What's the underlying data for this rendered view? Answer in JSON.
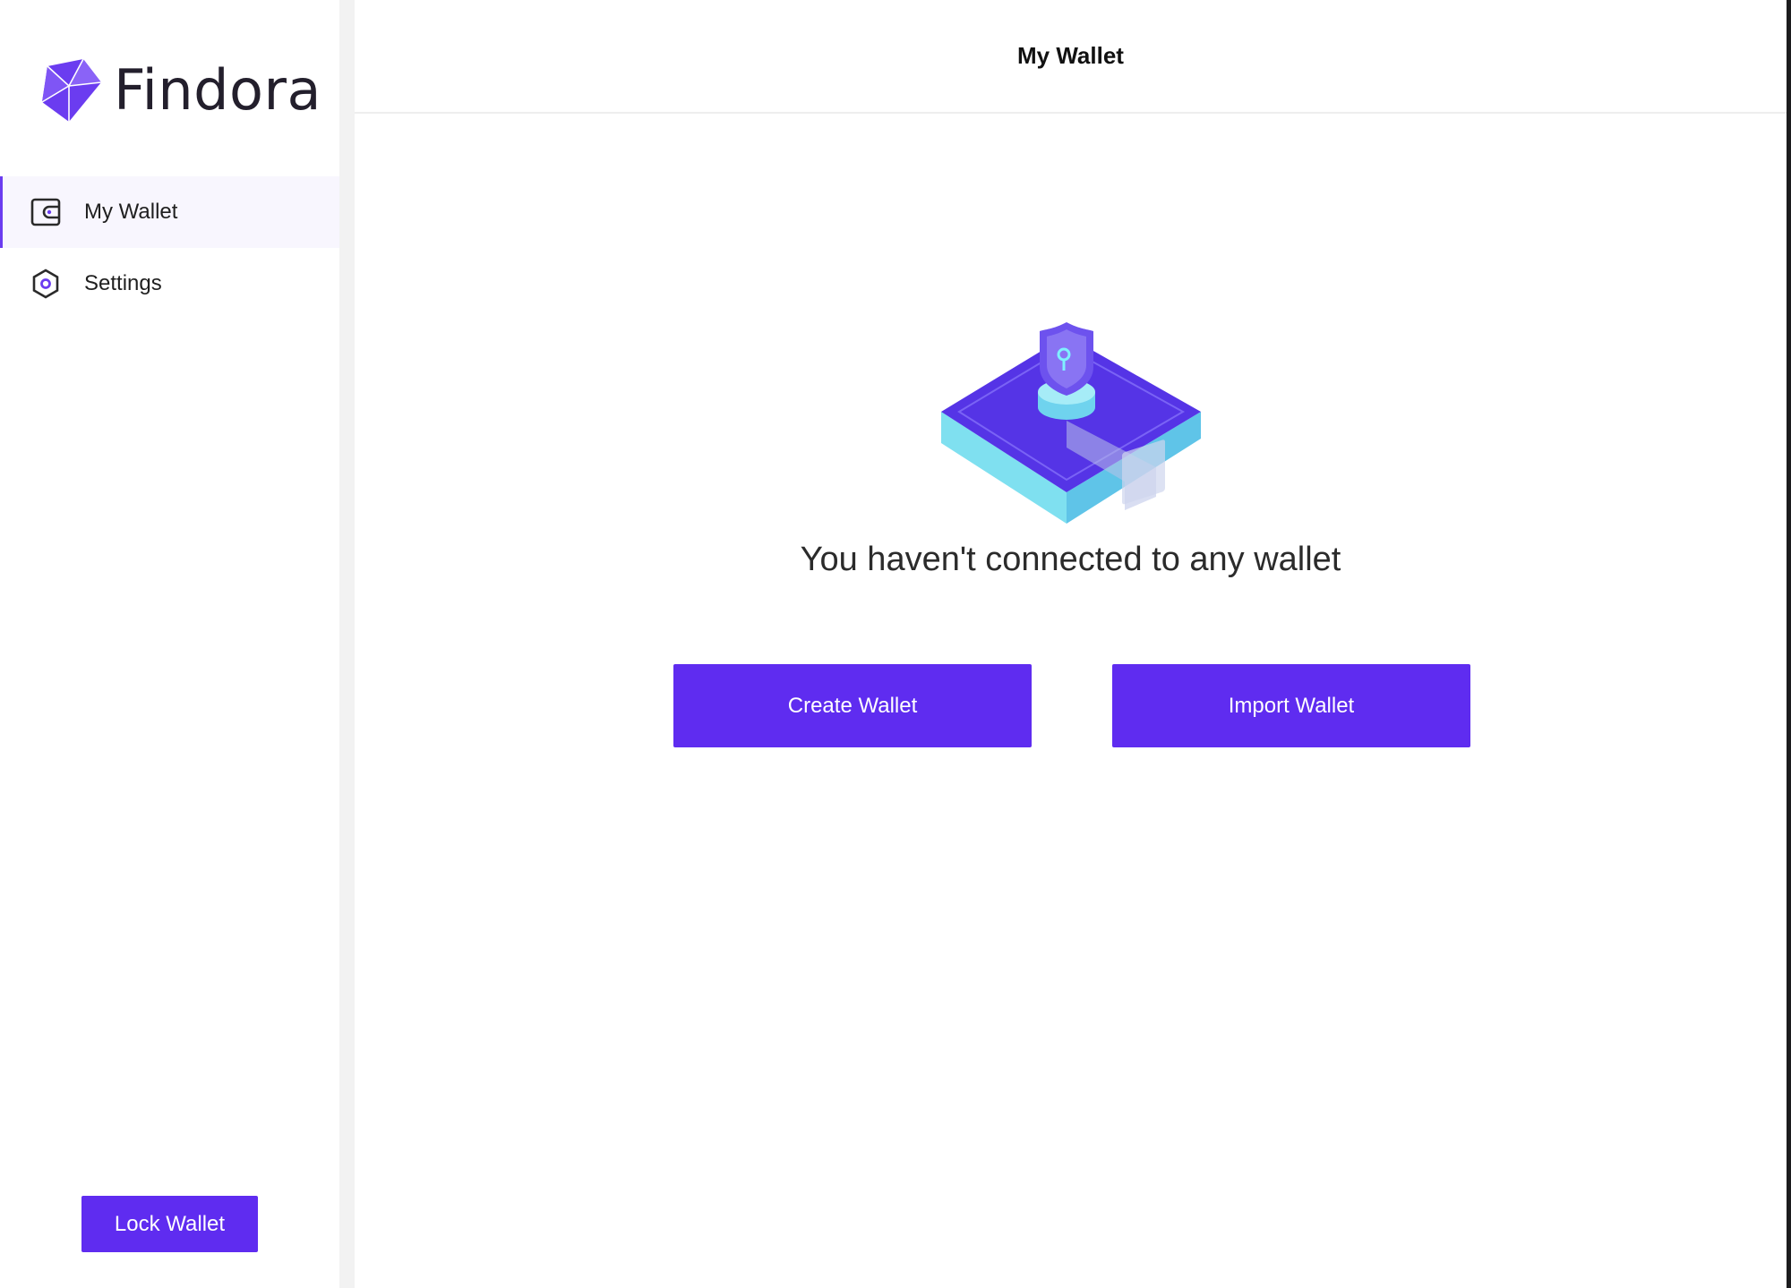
{
  "brand": {
    "name": "Findora",
    "accent_color": "#5f2cf0"
  },
  "sidebar": {
    "items": [
      {
        "label": "My Wallet",
        "icon": "wallet-icon",
        "active": true
      },
      {
        "label": "Settings",
        "icon": "hexagon-settings-icon",
        "active": false
      }
    ],
    "lock_label": "Lock Wallet"
  },
  "header": {
    "title": "My Wallet"
  },
  "main": {
    "illustration": "locked-wallet-illustration",
    "empty_message": "You haven't connected to any wallet",
    "create_label": "Create Wallet",
    "import_label": "Import Wallet"
  }
}
